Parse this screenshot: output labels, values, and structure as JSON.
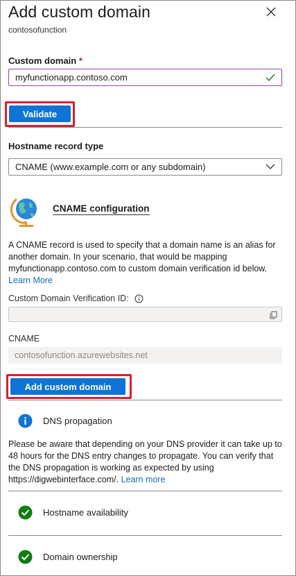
{
  "header": {
    "title": "Add custom domain",
    "subtitle": "contosofunction",
    "close_icon": "close-icon"
  },
  "custom_domain": {
    "label": "Custom domain",
    "required_marker": "*",
    "value": "myfunctionapp.contoso.com",
    "valid_icon": "checkmark-icon"
  },
  "validate_button": {
    "label": "Validate"
  },
  "hostname_record": {
    "label": "Hostname record type",
    "selected": "CNAME (www.example.com or any subdomain)"
  },
  "cname_config": {
    "title": "CNAME configuration",
    "icon": "globe-icon",
    "description": "A CNAME record is used to specify that a domain name is an alias for another domain. In your scenario, that would be mapping myfunctionapp.contoso.com to custom domain verification id below.",
    "learn_more": "Learn More",
    "verification_label": "Custom Domain Verification ID:",
    "verification_value": "",
    "cname_label": "CNAME",
    "cname_value": "contosofunction.azurewebsites.net"
  },
  "add_button": {
    "label": "Add custom domain"
  },
  "dns": {
    "title": "DNS propagation",
    "description": "Please be aware that depending on your DNS provider it can take up to 48 hours for the DNS entry changes to propagate. You can verify that the DNS propagation is working as expected by using https://digwebinterface.com/.",
    "learn_more": "Learn more"
  },
  "checks": [
    {
      "label": "Hostname availability",
      "status": "success"
    },
    {
      "label": "Domain ownership",
      "status": "success"
    }
  ],
  "colors": {
    "accent": "#0f74d6",
    "highlight": "#d91e32",
    "success": "#107c10",
    "input_focus": "#8d45a8"
  }
}
